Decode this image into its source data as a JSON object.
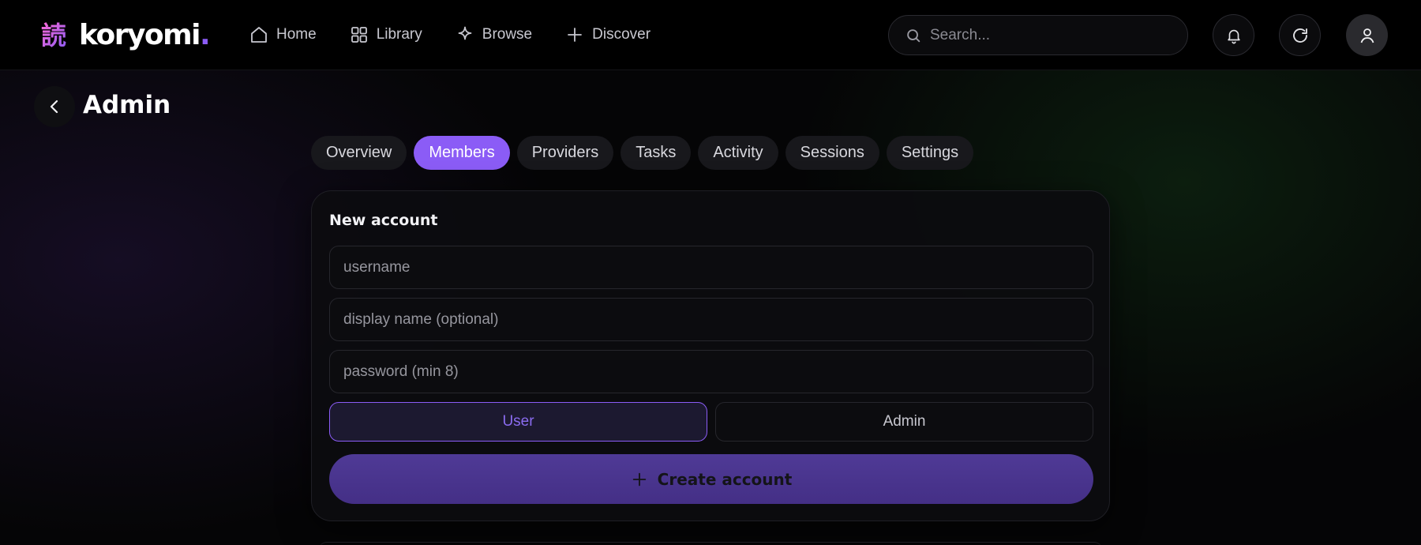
{
  "brand": {
    "glyph": "読",
    "name": "koryomi",
    "dot": ".",
    "accent": "#8b5cf6"
  },
  "nav": {
    "items": [
      {
        "label": "Home",
        "icon": "home-icon"
      },
      {
        "label": "Library",
        "icon": "grid-icon"
      },
      {
        "label": "Browse",
        "icon": "sparkle-icon"
      },
      {
        "label": "Discover",
        "icon": "plus-icon"
      }
    ]
  },
  "search": {
    "placeholder": "Search..."
  },
  "header": {
    "title": "Admin"
  },
  "tabs": [
    {
      "label": "Overview",
      "active": false
    },
    {
      "label": "Members",
      "active": true
    },
    {
      "label": "Providers",
      "active": false
    },
    {
      "label": "Tasks",
      "active": false
    },
    {
      "label": "Activity",
      "active": false
    },
    {
      "label": "Sessions",
      "active": false
    },
    {
      "label": "Settings",
      "active": false
    }
  ],
  "new_account": {
    "title": "New account",
    "username_placeholder": "username",
    "display_name_placeholder": "display name (optional)",
    "password_placeholder": "password (min 8)",
    "roles": {
      "user": "User",
      "admin": "Admin",
      "selected": "User"
    },
    "create_label": "Create account"
  }
}
